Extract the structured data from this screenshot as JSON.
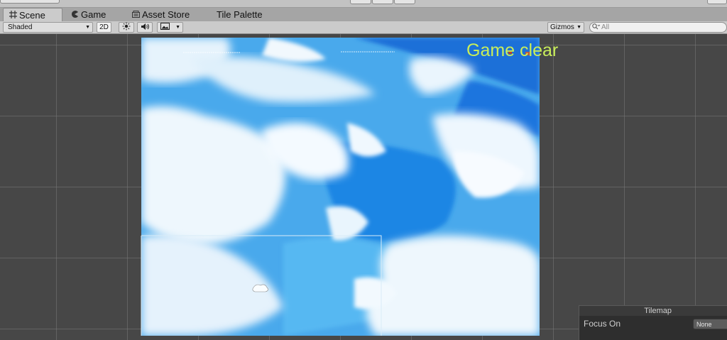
{
  "tabs": [
    {
      "label": "Scene",
      "icon": "grid-icon"
    },
    {
      "label": "Game",
      "icon": "pacman-icon"
    },
    {
      "label": "Asset Store",
      "icon": "store-icon"
    },
    {
      "label": "Tile Palette",
      "icon": ""
    }
  ],
  "toolbar": {
    "draw_mode": "Shaded",
    "mode_2d": "2D",
    "gizmos_label": "Gizmos",
    "search_placeholder": "All"
  },
  "scene": {
    "overlay_text": "Game clear"
  },
  "tilemap_panel": {
    "title": "Tilemap",
    "focus_label": "Focus On",
    "focus_value": "None"
  },
  "colors": {
    "overlay_text": "#c9ee5a",
    "viewport_bg": "#474747",
    "tab_bar": "#a5a5a5",
    "toolbar": "#cbcbcb"
  }
}
